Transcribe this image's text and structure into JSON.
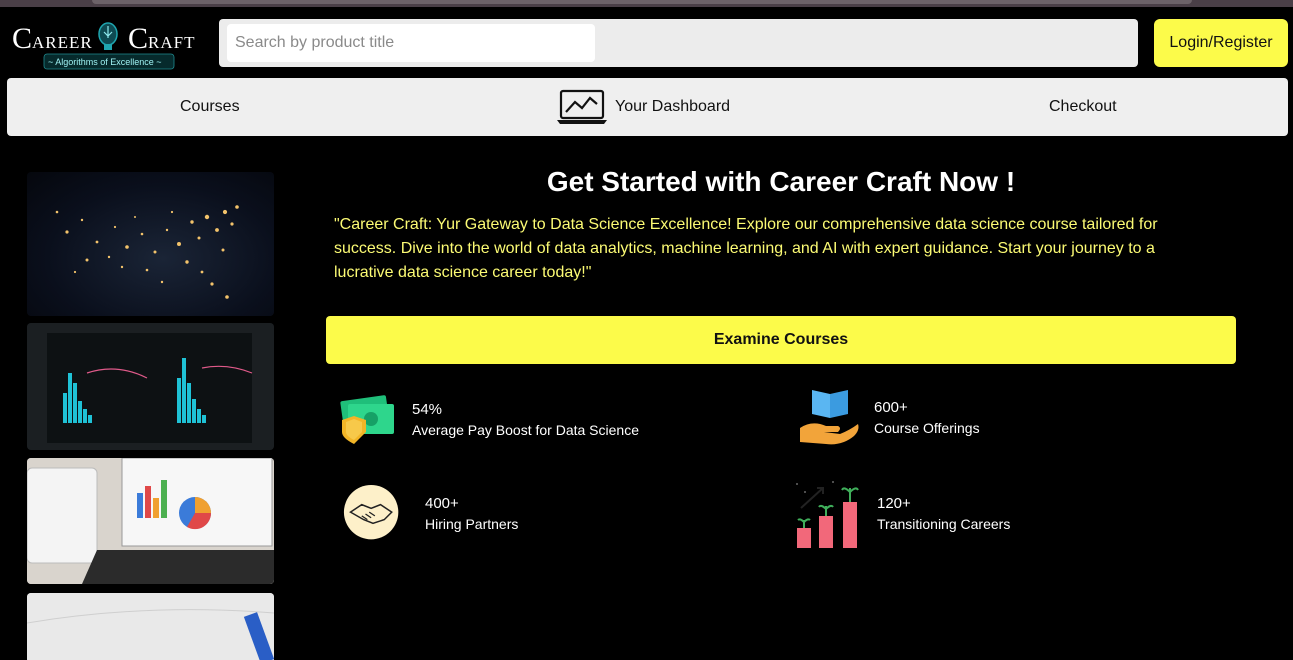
{
  "brand": {
    "logo_name": "Career Craft",
    "tagline": "Algorithms of Excellence"
  },
  "search": {
    "placeholder": "Search by product title",
    "value": ""
  },
  "header": {
    "login_label": "Login/Register"
  },
  "nav": {
    "items": [
      {
        "label": "Courses"
      },
      {
        "label": "Your Dashboard",
        "icon": "laptop-chart-icon"
      },
      {
        "label": "Checkout"
      }
    ]
  },
  "hero": {
    "title": "Get Started with Career Craft Now !",
    "quote": "\"Career Craft: Yur Gateway to Data Science Excellence! Explore our comprehensive data science course tailored for success. Dive into the world of data analytics, machine learning, and AI with expert guidance. Start your journey to a lucrative data science career today!\"",
    "cta_label": "Examine Courses"
  },
  "stats": [
    {
      "value": "54%",
      "label": "Average Pay Boost for Data Science",
      "icon": "money-shield-icon"
    },
    {
      "value": "600+",
      "label": "Course Offerings",
      "icon": "book-hand-icon"
    },
    {
      "value": "400+",
      "label": "Hiring Partners",
      "icon": "handshake-icon"
    },
    {
      "value": "120+",
      "label": "Transitioning Careers",
      "icon": "growth-chart-icon"
    }
  ],
  "colors": {
    "accent_yellow": "#fcfb4a",
    "quote_yellow": "#fcfb74",
    "background": "#000000",
    "nav_bg": "#efefef"
  }
}
